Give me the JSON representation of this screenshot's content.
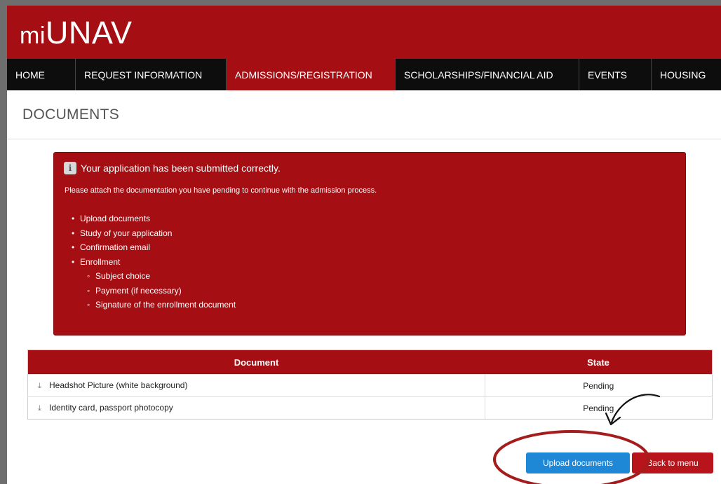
{
  "header": {
    "logo_prefix": "mi",
    "logo_main": "UNAV"
  },
  "nav": {
    "tabs": [
      {
        "label": "HOME"
      },
      {
        "label": "REQUEST INFORMATION"
      },
      {
        "label": "ADMISSIONS/REGISTRATION",
        "active": true
      },
      {
        "label": "SCHOLARSHIPS/FINANCIAL AID"
      },
      {
        "label": "EVENTS"
      },
      {
        "label": "HOUSING"
      }
    ]
  },
  "page": {
    "title": "DOCUMENTS"
  },
  "alert": {
    "icon": "info-icon",
    "title": "Your application has been submitted correctly.",
    "message": "Please attach the documentation you have pending to continue with the admission process.",
    "steps": [
      {
        "label": "Upload documents"
      },
      {
        "label": "Study of your application"
      },
      {
        "label": "Confirmation email"
      },
      {
        "label": "Enrollment"
      }
    ],
    "substeps": [
      {
        "label": "Subject choice"
      },
      {
        "label": "Payment (if necessary)"
      },
      {
        "label": "Signature of the enrollment document"
      }
    ]
  },
  "table": {
    "headers": {
      "document": "Document",
      "state": "State"
    },
    "rows": [
      {
        "document": "Headshot Picture (white background)",
        "state": "Pending"
      },
      {
        "document": "Identity card, passport photocopy",
        "state": "Pending"
      }
    ]
  },
  "buttons": {
    "upload": "Upload documents",
    "back": "Back to menu"
  },
  "colors": {
    "brand_red": "#a50e12",
    "nav_black": "#0d0d0d",
    "upload_blue": "#1e87d6"
  }
}
